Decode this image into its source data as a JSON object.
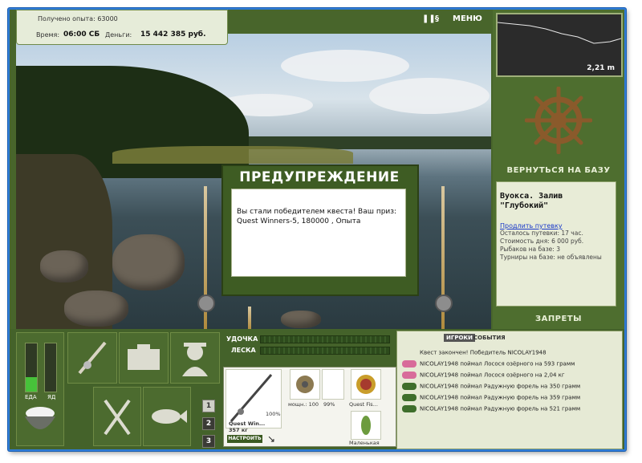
{
  "header": {
    "experience_label": "Получено опыта: 63000",
    "time_label": "Время:",
    "time_value": "06:00 СБ",
    "money_label": "Деньги:",
    "money_value": "15 442 385 руб.",
    "menu_label": "МЕНЮ"
  },
  "depth_panel": {
    "depth_value": "2,21 m"
  },
  "right_panel": {
    "return_label": "ВЕРНУТЬСЯ НА БАЗУ",
    "location_title": "Вуокса. Залив\n\"Глубокий\"",
    "extend_link": "Продлить путевку",
    "pass_left": "Осталось путевки: 17 час.",
    "day_cost": "Стоимость дня: 6 000 руб.",
    "fishers": "Рыбаков на базе: 3",
    "tournaments": "Турниры на базе: не объявлены",
    "bans_label": "ЗАПРЕТЫ"
  },
  "dialog": {
    "title": "ПРЕДУПРЕЖДЕНИЕ",
    "message": "Вы стали победителем квеста! Ваш приз: Quest Winners-5, 180000 , Опыта"
  },
  "status": {
    "food_label": "ЕДА",
    "poison_label": "ЯД",
    "food_level": 0.3,
    "poison_level": 0.0
  },
  "number_buttons": [
    "1",
    "2",
    "3"
  ],
  "gauges": {
    "rod_label": "УДОЧКА",
    "line_label": "ЛЕСКА"
  },
  "tackle": {
    "rod_percent": "100%",
    "rod_name": "Quest Win...",
    "rod_weight": "357 кг",
    "setup_button": "НАСТРОИТЬ",
    "reel_power": "мощн.: 100",
    "reel_percent": "99%",
    "lure_name": "Quest Fis...",
    "bait_name": "Маленькая"
  },
  "events": {
    "tab_players": "ИГРОКИ",
    "tab_events": "СОБЫТИЯ",
    "items": [
      {
        "text": "Квест закончен! Победитель NICOLAY1948",
        "icon": "none"
      },
      {
        "text": "NICOLAY1948 поймал Лосося озёрного на 593 грамм",
        "icon": "pink-fish",
        "color": "#d86b9a"
      },
      {
        "text": "NICOLAY1948 поймал Лосося озёрного на 2,04 кг",
        "icon": "pink-fish",
        "color": "#d86b9a"
      },
      {
        "text": "NICOLAY1948 поймал Радужную форель на 350 грамм",
        "icon": "trout",
        "color": "#3e6e2b"
      },
      {
        "text": "NICOLAY1948 поймал Радужную форель на 359 грамм",
        "icon": "trout",
        "color": "#3e6e2b"
      },
      {
        "text": "NICOLAY1948 поймал Радужную форель на 521 грамм",
        "icon": "trout",
        "color": "#3e6e2b"
      }
    ]
  }
}
